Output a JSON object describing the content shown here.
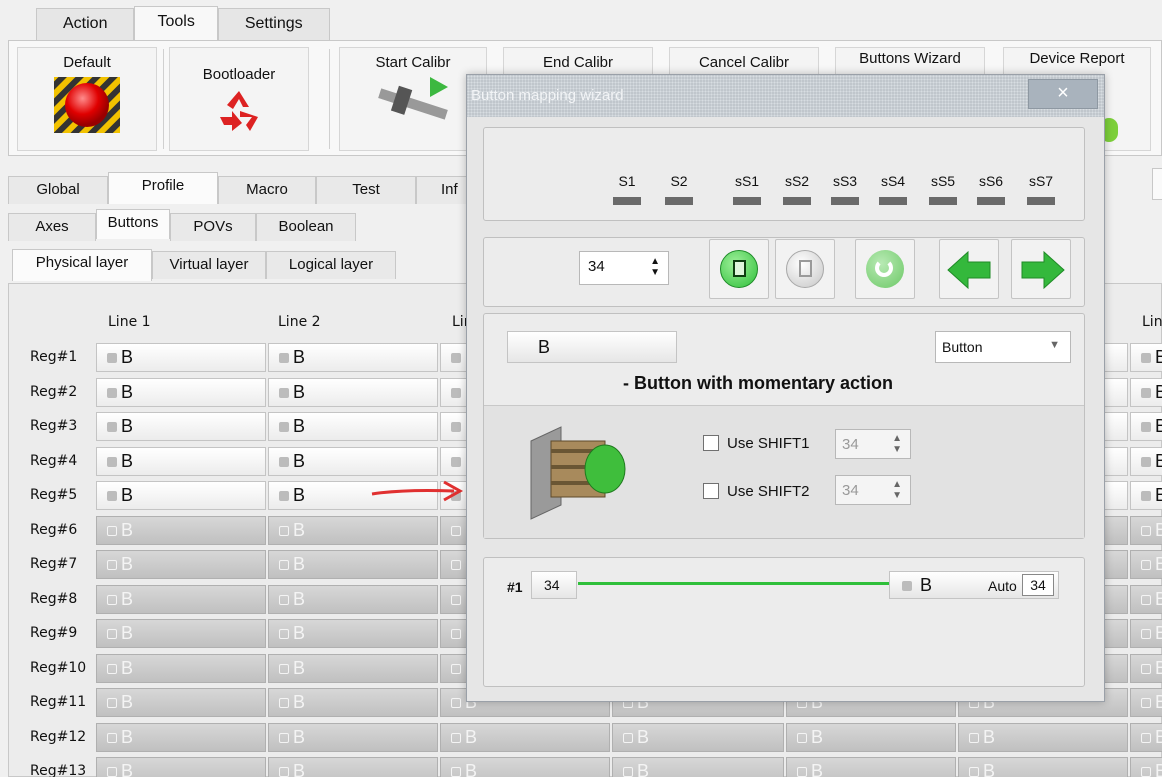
{
  "menu_tabs": [
    "Action",
    "Tools",
    "Settings"
  ],
  "ribbon": {
    "default_label": "Default",
    "bootloader_label": "Bootloader",
    "start_calibr_label": "Start Calibr",
    "end_calibr_label": "End Calibr",
    "cancel_calibr_label": "Cancel Calibr",
    "buttons_wizard_label": "Buttons Wizard",
    "device_report_label": "Device Report"
  },
  "main_tabs": [
    "Global",
    "Profile",
    "Macro",
    "Test",
    "Inf"
  ],
  "sub_tabs": [
    "Axes",
    "Buttons",
    "POVs",
    "Boolean"
  ],
  "layer_tabs": [
    "Physical layer",
    "Virtual layer",
    "Logical layer"
  ],
  "grid": {
    "columns": [
      "Line 1",
      "Line 2",
      "Lin",
      "Lin"
    ],
    "rows": [
      "Reg#1",
      "Reg#2",
      "Reg#3",
      "Reg#4",
      "Reg#5",
      "Reg#6",
      "Reg#7",
      "Reg#8",
      "Reg#9",
      "Reg#10",
      "Reg#11",
      "Reg#12",
      "Reg#13"
    ],
    "cell_text": "B"
  },
  "wizard": {
    "title": "Button mapping wizard",
    "close_icon": "×",
    "shift_labels": [
      "S1",
      "S2",
      "sS1",
      "sS2",
      "sS3",
      "sS4",
      "sS5",
      "sS6",
      "sS7"
    ],
    "button_number": "34",
    "button_name": "B",
    "type_select": "Button",
    "description": "- Button with momentary action",
    "use_shift1_label": "Use SHIFT1",
    "use_shift1_value": "34",
    "use_shift2_label": "Use SHIFT2",
    "use_shift2_value": "34",
    "mapping": {
      "index_label": "#1",
      "source_value": "34",
      "target_name": "B",
      "auto_label": "Auto",
      "target_value": "34"
    }
  },
  "colors": {
    "green": "#2fbf3a",
    "red_arrow": "#e03030"
  }
}
